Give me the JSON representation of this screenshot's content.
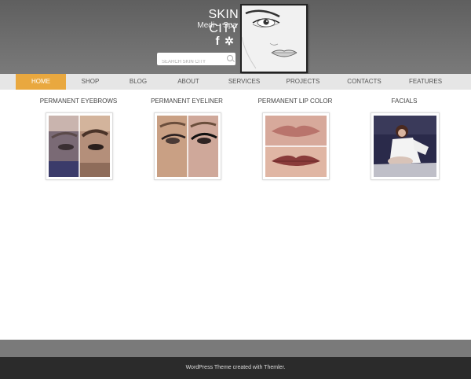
{
  "brand": {
    "title": "SKIN CITY",
    "subtitle": "Medi – Spa"
  },
  "social": {
    "facebook": "f",
    "yelp": "✲"
  },
  "search": {
    "placeholder": "SEARCH SKIN CITY"
  },
  "nav": {
    "items": [
      {
        "label": "HOME"
      },
      {
        "label": "SHOP"
      },
      {
        "label": "BLOG"
      },
      {
        "label": "ABOUT"
      },
      {
        "label": "SERVICES"
      },
      {
        "label": "PROJECTS"
      },
      {
        "label": "CONTACTS"
      },
      {
        "label": "FEATURES"
      }
    ],
    "active_color": "#e9a83f"
  },
  "services": [
    {
      "title": "PERMANENT EYEBROWS"
    },
    {
      "title": "PERMANENT EYELINER"
    },
    {
      "title": "PERMANENT LIP COLOR"
    },
    {
      "title": "FACIALS"
    }
  ],
  "footer": {
    "text": "WordPress Theme created with Themler."
  }
}
